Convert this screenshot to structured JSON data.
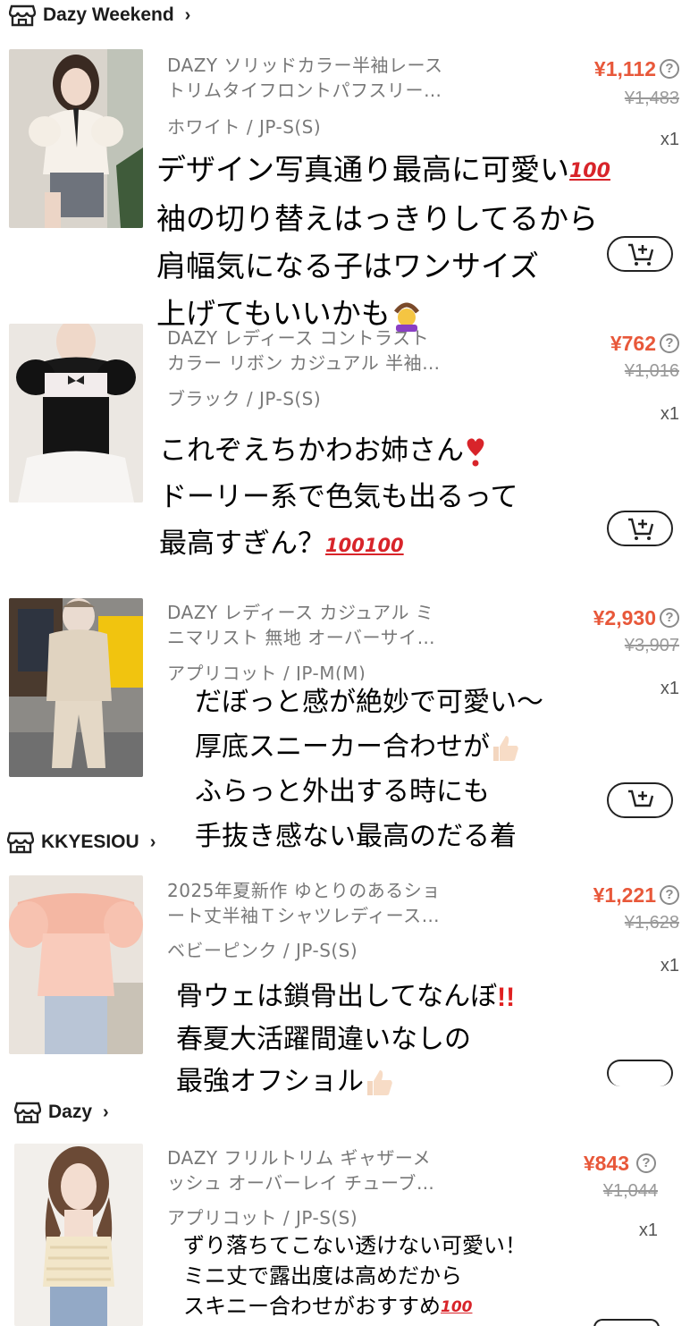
{
  "stores": [
    {
      "name": "Dazy Weekend"
    },
    {
      "name": "KKYESIOU"
    },
    {
      "name": "Dazy"
    }
  ],
  "products": [
    {
      "title_lines": [
        "DAZY ソリッドカラー半袖レース",
        "トリムタイフロントパフスリー…"
      ],
      "variant": "ホワイト / JP-S(S)",
      "price": "¥1,112",
      "original_price": "¥1,483",
      "qty": "x1",
      "review_lines": [
        "デザイン写真通り最高に可愛い",
        "袖の切り替えはっきりしてるから",
        "肩幅気になる子はワンサイズ",
        "上げてもいいかも"
      ],
      "review_emojis": [
        "hundred-points-emoji",
        "person-gesturing-ok-emoji"
      ]
    },
    {
      "title_lines": [
        "DAZY レディース コントラスト",
        "カラー リボン カジュアル 半袖…"
      ],
      "variant": "ブラック / JP-S(S)",
      "price": "¥762",
      "original_price": "¥1,016",
      "qty": "x1",
      "review_lines": [
        "これぞえちかわお姉さん",
        "ドーリー系で色気も出るって",
        "最高すぎん？"
      ],
      "review_emojis": [
        "heart-exclamation-emoji",
        "hundred-points-emoji"
      ]
    },
    {
      "title_lines": [
        "DAZY レディース カジュアル ミ",
        "ニマリスト 無地 オーバーサイ…"
      ],
      "variant": "アプリコット / JP-M(M)",
      "price": "¥2,930",
      "original_price": "¥3,907",
      "qty": "x1",
      "review_lines": [
        "だぼっと感が絶妙で可愛い〜",
        "厚底スニーカー合わせが",
        "ふらっと外出する時にも",
        "手抜き感ない最高のだる着"
      ],
      "review_emojis": [
        "thumbs-up-emoji"
      ]
    },
    {
      "title_lines": [
        "2025年夏新作 ゆとりのあるショ",
        "ート丈半袖Ｔシャツレディース…"
      ],
      "variant": "ベビーピンク / JP-S(S)",
      "price": "¥1,221",
      "original_price": "¥1,628",
      "qty": "x1",
      "review_lines": [
        "骨ウェは鎖骨出してなんぼ",
        "春夏大活躍間違いなしの",
        "最強オフショル"
      ],
      "review_emojis": [
        "double-exclamation-emoji",
        "thumbs-up-emoji"
      ]
    },
    {
      "title_lines": [
        "DAZY フリルトリム ギャザーメ",
        "ッシュ オーバーレイ チューブ…"
      ],
      "variant": "アプリコット / JP-S(S)",
      "price": "¥843",
      "original_price": "¥1,044",
      "qty": "x1",
      "review_lines": [
        "ずり落ちてこない透けない可愛い！",
        "ミニ丈で露出度は高めだから",
        "スキニー合わせがおすすめ"
      ],
      "review_emojis": [
        "hundred-points-emoji"
      ]
    }
  ],
  "icons": {
    "store": "store-icon",
    "chevron": "chevron-right-icon",
    "help": "question-circle-icon",
    "cart": "add-to-cart-icon"
  },
  "symbols": {
    "chevron": "›",
    "help": "?"
  },
  "colors": {
    "price": "#e8583a",
    "muted": "#777777",
    "text": "#1c1c1c"
  }
}
